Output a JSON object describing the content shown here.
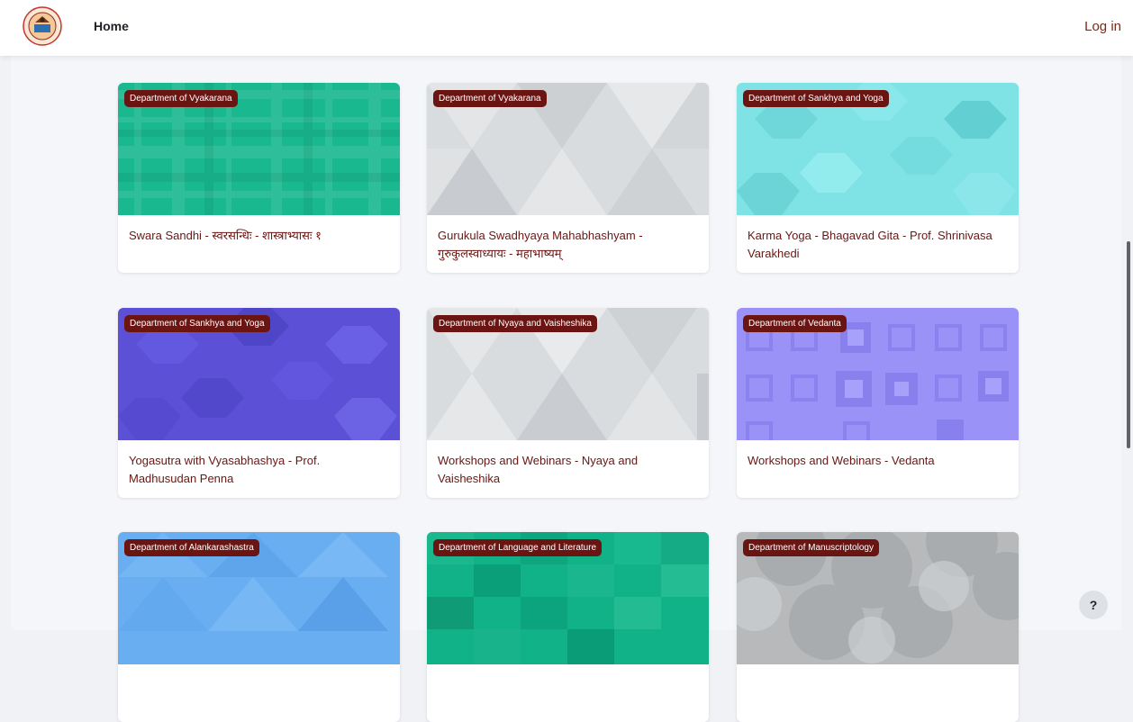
{
  "nav": {
    "home_label": "Home",
    "login_label": "Log in"
  },
  "courses": [
    {
      "category": "Department of Vyakarana",
      "title": "Swara Sandhi - स्वरसन्धिः - शास्त्राभ्यासः १",
      "pattern_color": "#19b88f"
    },
    {
      "category": "Department of Vyakarana",
      "title": "Gurukula Swadhyaya Mahabhashyam - गुरुकुलस्वाध्यायः - महाभाष्यम्",
      "pattern_color": "#d9dcde"
    },
    {
      "category": "Department of Sankhya and Yoga",
      "title": "Karma Yoga - Bhagavad Gita - Prof. Shrinivasa Varakhedi",
      "pattern_color": "#7fe3e6"
    },
    {
      "category": "Department of Sankhya and Yoga",
      "title": "Yogasutra with Vyasabhashya - Prof. Madhusudan Penna",
      "pattern_color": "#5b50d6"
    },
    {
      "category": "Department of Nyaya and Vaisheshika",
      "title": "Workshops and Webinars - Nyaya and Vaisheshika",
      "pattern_color": "#d9dcde"
    },
    {
      "category": "Department of Vedanta",
      "title": "Workshops and Webinars - Vedanta",
      "pattern_color": "#9a92f7"
    },
    {
      "category": "Department of Alankarashastra",
      "title": "",
      "pattern_color": "#6aaef2"
    },
    {
      "category": "Department of Language and Literature",
      "title": "",
      "pattern_color": "#12b288"
    },
    {
      "category": "Department of Manuscriptology",
      "title": "",
      "pattern_color": "#b7b9bb"
    }
  ],
  "help_label": "?"
}
